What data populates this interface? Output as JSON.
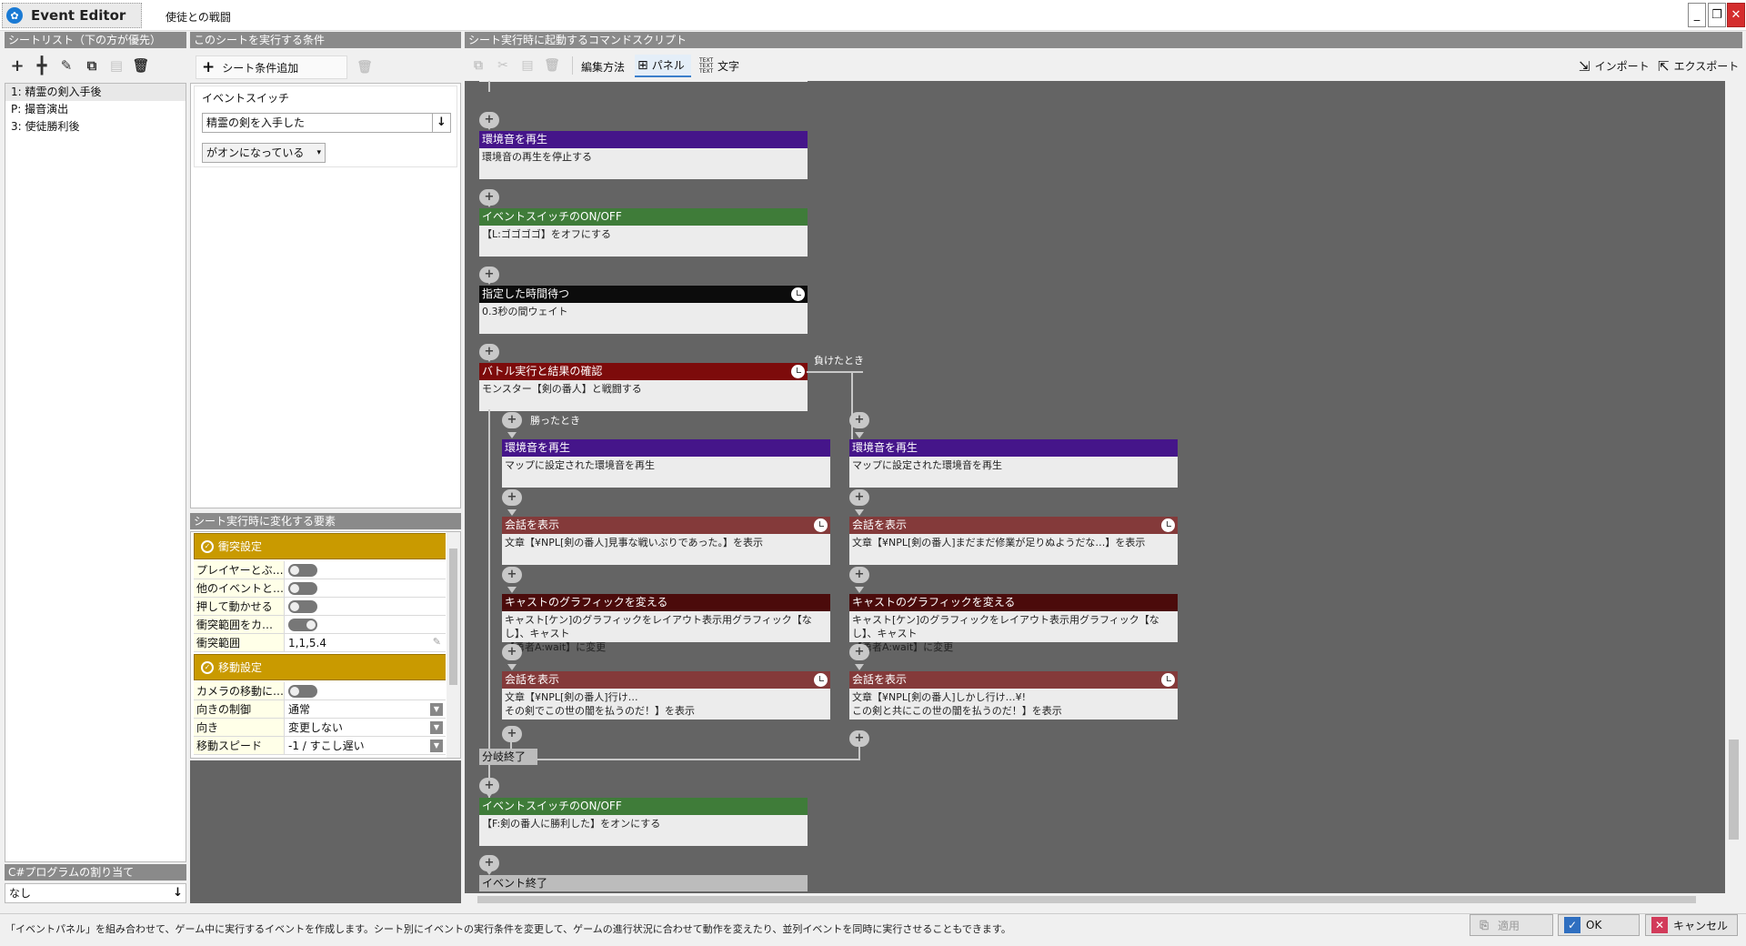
{
  "window": {
    "app_title": "Event Editor",
    "document_title": "使徒との戦闘"
  },
  "sheet_list": {
    "header": "シートリスト（下の方が優先）",
    "items": [
      "1: 精霊の剣入手後",
      "P: 撮音演出",
      "3: 使徒勝利後"
    ],
    "selected_index": 0,
    "csharp_header": "C#プログラムの割り当て",
    "csharp_value": "なし"
  },
  "conditions": {
    "header": "このシートを実行する条件",
    "add_label": "シート条件追加",
    "type_label": "イベントスイッチ",
    "switch_value": "精霊の剣を入手した",
    "state_value": "がオンになっている"
  },
  "properties": {
    "header": "シート実行時に変化する要素",
    "groups": [
      {
        "title": "衝突設定",
        "rows": [
          {
            "label": "プレイヤーとぶ…",
            "kind": "toggle",
            "on": false
          },
          {
            "label": "他のイベントと…",
            "kind": "toggle",
            "on": false
          },
          {
            "label": "押して動かせる",
            "kind": "toggle",
            "on": false
          },
          {
            "label": "衝突範囲をカ…",
            "kind": "toggle",
            "on": true
          },
          {
            "label": "衝突範囲",
            "kind": "text",
            "value": "1,1,5.4"
          }
        ]
      },
      {
        "title": "移動設定",
        "rows": [
          {
            "label": "カメラの移動に…",
            "kind": "toggle",
            "on": false
          },
          {
            "label": "向きの制御",
            "kind": "select",
            "value": "通常"
          },
          {
            "label": "向き",
            "kind": "select",
            "value": "変更しない"
          },
          {
            "label": "移動スピード",
            "kind": "select",
            "value": "-1 / すこし遅い"
          }
        ]
      }
    ]
  },
  "script": {
    "header": "シート実行時に起動するコマンドスクリプト",
    "edit_mode_label": "編集方法",
    "panel_tab": "パネル",
    "text_tab": "文字",
    "import_label": "インポート",
    "export_label": "エクスポート",
    "branch_win_label": "勝ったとき",
    "branch_lose_label": "負けたとき",
    "branch_end_label": "分岐終了",
    "event_end_label": "イベント終了",
    "main": [
      {
        "title": "環境音を再生",
        "body": [
          "環境音の再生を停止する"
        ],
        "color": "pur",
        "clock": false
      },
      {
        "title": "イベントスイッチのON/OFF",
        "body": [
          "【L:ゴゴゴゴ】をオフにする"
        ],
        "color": "grn",
        "clock": false
      },
      {
        "title": "指定した時間待つ",
        "body": [
          "0.3秒の間ウェイト"
        ],
        "color": "blk",
        "clock": true
      },
      {
        "title": "バトル実行と結果の確認",
        "body": [
          "モンスター【剣の番人】と戦闘する"
        ],
        "color": "red",
        "clock": true
      }
    ],
    "win": [
      {
        "title": "環境音を再生",
        "body": [
          "マップに設定された環境音を再生"
        ],
        "color": "pur",
        "clock": false
      },
      {
        "title": "会話を表示",
        "body": [
          "文章【¥NPL[剣の番人]見事な戦いぶりであった。】を表示"
        ],
        "color": "mar",
        "clock": true
      },
      {
        "title": "キャストのグラフィックを変える",
        "body": [
          "キャスト[ケン]のグラフィックをレイアウト表示用グラフィック【なし】、キャスト",
          "【勇者A:wait】に変更"
        ],
        "color": "dkr",
        "clock": false
      },
      {
        "title": "会話を表示",
        "body": [
          "文章【¥NPL[剣の番人]行け…",
          "その剣でこの世の闇を払うのだ！】を表示"
        ],
        "color": "mar",
        "clock": true
      }
    ],
    "lose": [
      {
        "title": "環境音を再生",
        "body": [
          "マップに設定された環境音を再生"
        ],
        "color": "pur",
        "clock": false
      },
      {
        "title": "会話を表示",
        "body": [
          "文章【¥NPL[剣の番人]まだまだ修業が足りぬようだな…】を表示"
        ],
        "color": "mar",
        "clock": true
      },
      {
        "title": "キャストのグラフィックを変える",
        "body": [
          "キャスト[ケン]のグラフィックをレイアウト表示用グラフィック【なし】、キャスト",
          "【勇者A:wait】に変更"
        ],
        "color": "dkr",
        "clock": false
      },
      {
        "title": "会話を表示",
        "body": [
          "文章【¥NPL[剣の番人]しかし行け…¥!",
          "この剣と共にこの世の闇を払うのだ！】を表示"
        ],
        "color": "mar",
        "clock": true
      }
    ],
    "after": [
      {
        "title": "イベントスイッチのON/OFF",
        "body": [
          "【F:剣の番人に勝利した】をオンにする"
        ],
        "color": "grn",
        "clock": false
      }
    ]
  },
  "footer": {
    "status_text": "「イベントパネル」を組み合わせて、ゲーム中に実行するイベントを作成します。シート別にイベントの実行条件を変更して、ゲームの進行状況に合わせて動作を変えたり、並列イベントを同時に実行させることもできます。",
    "apply_label": "適用",
    "ok_label": "OK",
    "cancel_label": "キャンセル"
  }
}
